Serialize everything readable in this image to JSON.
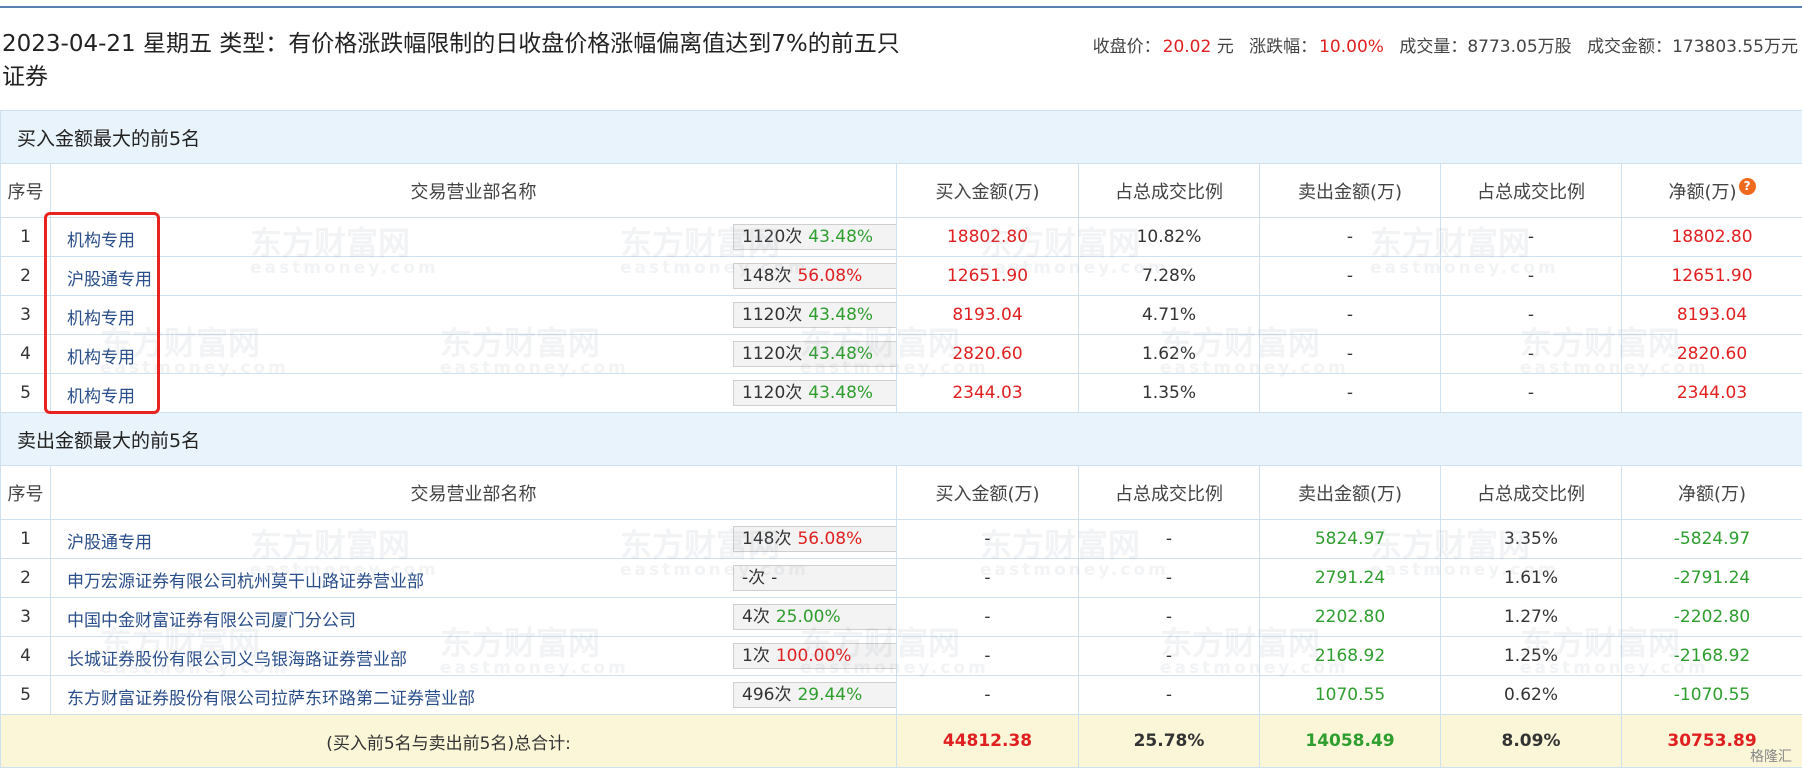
{
  "title": "2023-04-21 星期五 类型：有价格涨跌幅限制的日收盘价格涨幅偏离值达到7%的前五只证券",
  "stats": {
    "close_label": "收盘价：",
    "close_value": "20.02",
    "close_unit": "元",
    "change_label": "涨跌幅：",
    "change_value": "10.00%",
    "volume_label": "成交量：",
    "volume_value": "8773.05万股",
    "amount_label": "成交金额：",
    "amount_value": "173803.55万元"
  },
  "buy_section": {
    "title": "买入金额最大的前5名",
    "headers": [
      "序号",
      "交易营业部名称",
      "买入金额(万)",
      "占总成交比例",
      "卖出金额(万)",
      "占总成交比例",
      "净额(万)"
    ],
    "rows": [
      {
        "idx": "1",
        "name": "机构专用",
        "count": "1120次",
        "pct": "43.48%",
        "icon": "question-icon",
        "buy": "18802.80",
        "buy_ratio": "10.82%",
        "sell": "-",
        "sell_ratio": "-",
        "net": "18802.80"
      },
      {
        "idx": "2",
        "name": "沪股通专用",
        "count": "148次",
        "pct": "56.08%",
        "icon": "arrow-right-icon",
        "buy": "12651.90",
        "buy_ratio": "7.28%",
        "sell": "-",
        "sell_ratio": "-",
        "net": "12651.90"
      },
      {
        "idx": "3",
        "name": "机构专用",
        "count": "1120次",
        "pct": "43.48%",
        "icon": "arrow-right-icon",
        "buy": "8193.04",
        "buy_ratio": "4.71%",
        "sell": "-",
        "sell_ratio": "-",
        "net": "8193.04"
      },
      {
        "idx": "4",
        "name": "机构专用",
        "count": "1120次",
        "pct": "43.48%",
        "icon": "arrow-right-icon",
        "buy": "2820.60",
        "buy_ratio": "1.62%",
        "sell": "-",
        "sell_ratio": "-",
        "net": "2820.60"
      },
      {
        "idx": "5",
        "name": "机构专用",
        "count": "1120次",
        "pct": "43.48%",
        "icon": "arrow-right-icon",
        "buy": "2344.03",
        "buy_ratio": "1.35%",
        "sell": "-",
        "sell_ratio": "-",
        "net": "2344.03"
      }
    ]
  },
  "sell_section": {
    "title": "卖出金额最大的前5名",
    "headers": [
      "序号",
      "交易营业部名称",
      "买入金额(万)",
      "占总成交比例",
      "卖出金额(万)",
      "占总成交比例",
      "净额(万)"
    ],
    "rows": [
      {
        "idx": "1",
        "name": "沪股通专用",
        "count": "148次",
        "pct": "56.08%",
        "pct_color": "red",
        "icon": "question-icon",
        "buy": "-",
        "buy_ratio": "-",
        "sell": "5824.97",
        "sell_ratio": "3.35%",
        "net": "-5824.97"
      },
      {
        "idx": "2",
        "name": "申万宏源证券有限公司杭州莫干山路证券营业部",
        "count": "-次",
        "pct": "-",
        "pct_color": "gray",
        "icon": "arrow-right-icon",
        "buy": "-",
        "buy_ratio": "-",
        "sell": "2791.24",
        "sell_ratio": "1.61%",
        "net": "-2791.24"
      },
      {
        "idx": "3",
        "name": "中国中金财富证券有限公司厦门分公司",
        "count": "4次",
        "pct": "25.00%",
        "pct_color": "green",
        "icon": "arrow-right-icon",
        "buy": "-",
        "buy_ratio": "-",
        "sell": "2202.80",
        "sell_ratio": "1.27%",
        "net": "-2202.80"
      },
      {
        "idx": "4",
        "name": "长城证券股份有限公司义乌银海路证券营业部",
        "count": "1次",
        "pct": "100.00%",
        "pct_color": "red",
        "icon": "arrow-right-icon",
        "buy": "-",
        "buy_ratio": "-",
        "sell": "2168.92",
        "sell_ratio": "1.25%",
        "net": "-2168.92"
      },
      {
        "idx": "5",
        "name": "东方财富证券股份有限公司拉萨东环路第二证券营业部",
        "count": "496次",
        "pct": "29.44%",
        "pct_color": "green",
        "icon": "arrow-right-icon",
        "buy": "-",
        "buy_ratio": "-",
        "sell": "1070.55",
        "sell_ratio": "0.62%",
        "net": "-1070.55"
      }
    ]
  },
  "total": {
    "label": "(买入前5名与卖出前5名)总合计:",
    "buy": "44812.38",
    "buy_ratio": "25.78%",
    "sell": "14058.49",
    "sell_ratio": "8.09%",
    "net": "30753.89"
  },
  "watermark": {
    "cn": "东方财富网",
    "en": "eastmoney.com"
  },
  "source_badge": "格隆汇",
  "colors": {
    "up": "#e02020",
    "down": "#2e9e2e",
    "link": "#2a4e8a",
    "section_bg": "#e9f3fb",
    "total_bg": "#fbf6d8",
    "border": "#cfe0ee",
    "highlight_box": "#e8231f"
  }
}
